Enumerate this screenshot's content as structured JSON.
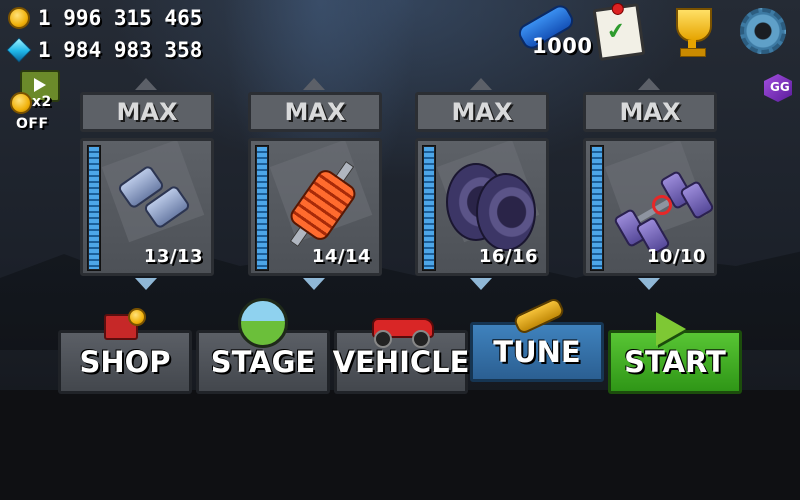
{
  "currency": {
    "coins": "1 996 315 465",
    "gems": "1 984 983 358"
  },
  "double_coins": {
    "multiplier": "x2",
    "status": "OFF"
  },
  "fuel": {
    "value": "1000"
  },
  "upgrades": [
    {
      "label": "MAX",
      "level": "13/13",
      "fill": 1.0,
      "icon": "engine-icon"
    },
    {
      "label": "MAX",
      "level": "14/14",
      "fill": 1.0,
      "icon": "suspension-icon"
    },
    {
      "label": "MAX",
      "level": "16/16",
      "fill": 1.0,
      "icon": "tires-icon"
    },
    {
      "label": "MAX",
      "level": "10/10",
      "fill": 1.0,
      "icon": "4wd-icon"
    }
  ],
  "menu": {
    "shop": "SHOP",
    "stage": "STAGE",
    "vehicle": "VEHICLE",
    "tune": "TUNE",
    "start": "START"
  },
  "overlay": {
    "gg_label": "GG"
  },
  "colors": {
    "menu_gray": "#4d5157",
    "menu_active": "#3573a8",
    "start_green": "#45ae26",
    "meter_blue": "#4da6e8"
  }
}
